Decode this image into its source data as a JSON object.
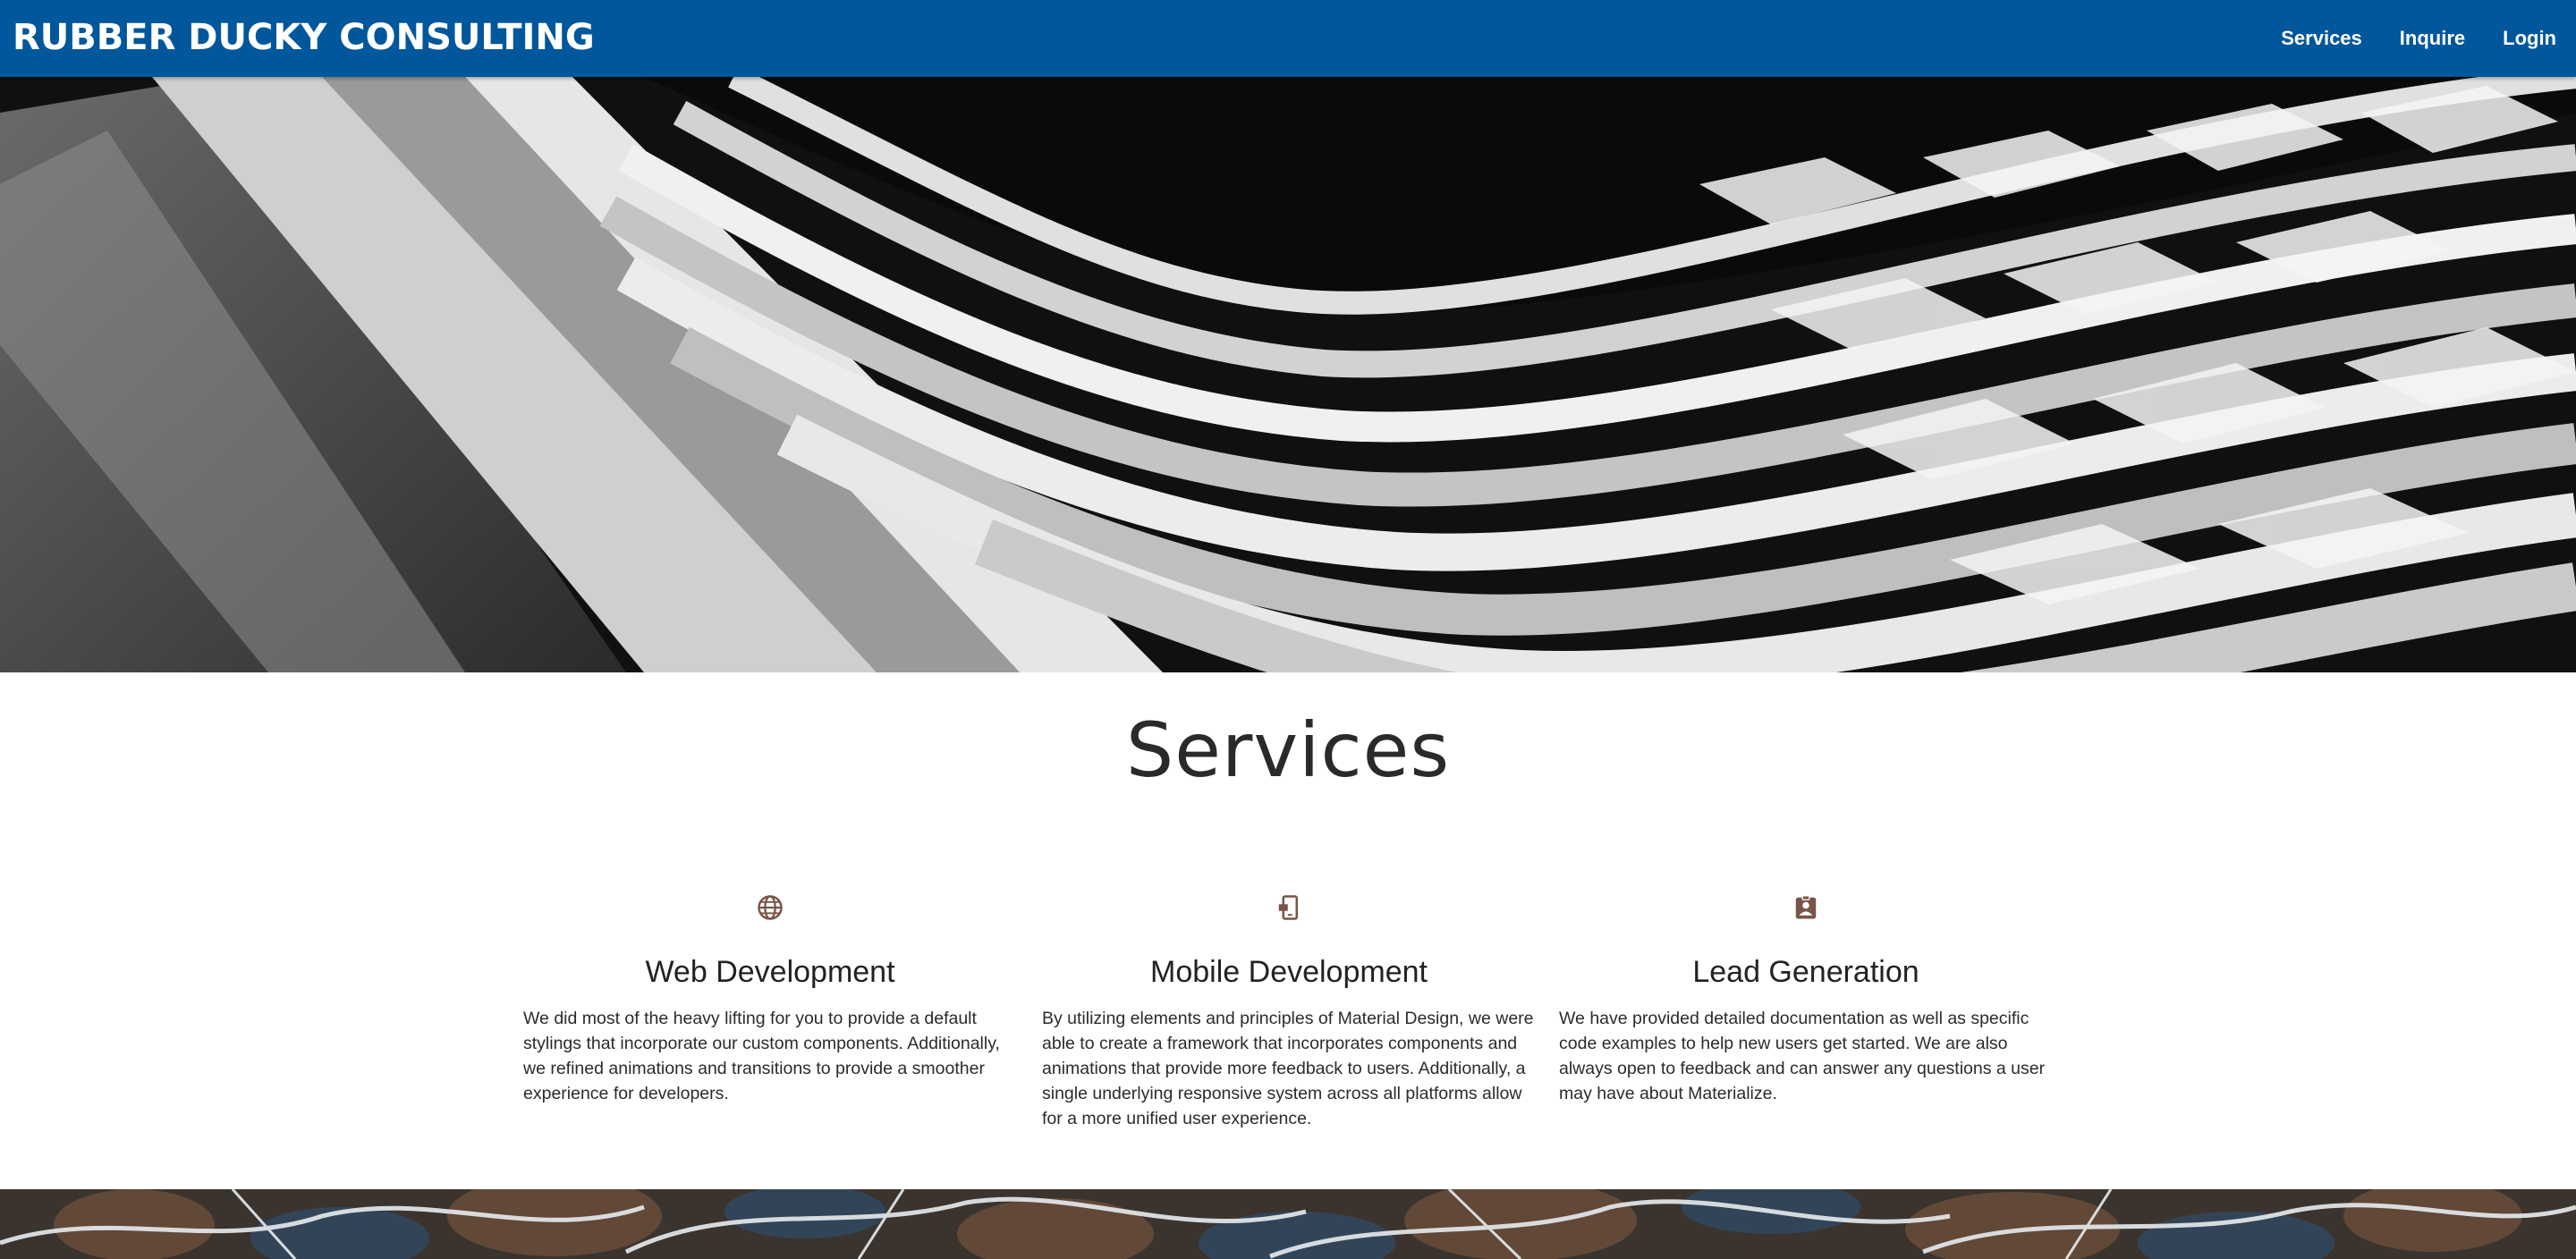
{
  "navbar": {
    "brand": "RUBBER DUCKY CONSULTING",
    "links": [
      "Services",
      "Inquire",
      "Login"
    ],
    "background": "#01579b"
  },
  "hero": {
    "image": "black-and-white abstract architectural waves"
  },
  "services": {
    "title": "Services",
    "items": [
      {
        "icon": "globe-icon",
        "heading": "Web Development",
        "text": "We did most of the heavy lifting for you to provide a default stylings that incorporate our custom components. Additionally, we refined animations and transitions to provide a smoother experience for developers."
      },
      {
        "icon": "phone-link-icon",
        "heading": "Mobile Development",
        "text": "By utilizing elements and principles of Material Design, we were able to create a framework that incorporates components and animations that provide more feedback to users. Additionally, a single underlying responsive system across all platforms allow for a more unified user experience."
      },
      {
        "icon": "assignment-ind-icon",
        "heading": "Lead Generation",
        "text": "We have provided detailed documentation as well as specific code examples to help new users get started. We are also always open to feedback and can answer any questions a user may have about Materialize."
      }
    ],
    "icon_color": "#795548"
  },
  "footer_banner": {
    "image": "marble stone texture"
  }
}
